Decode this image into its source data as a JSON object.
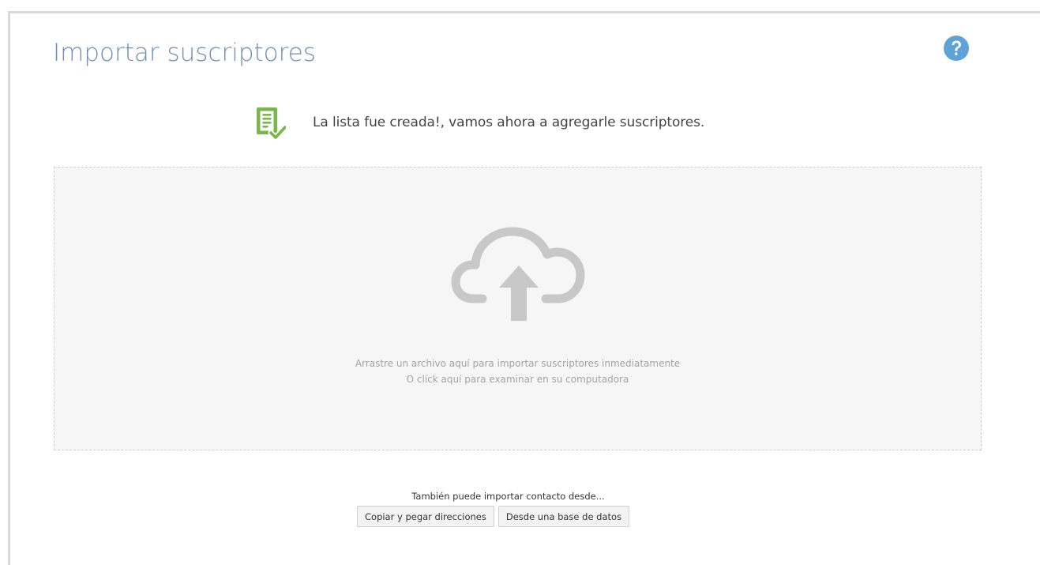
{
  "header": {
    "title": "Importar suscriptores",
    "help_icon": "question-circle-icon"
  },
  "notice": {
    "icon": "list-check-icon",
    "icon_color": "#7ab648",
    "text": "La lista fue creada!, vamos ahora a agregarle suscriptores."
  },
  "dropzone": {
    "icon": "cloud-upload-icon",
    "line1": "Arrastre un archivo aquí para importar suscriptores inmediatamente",
    "line2": "O click aquí para examinar en su computadora"
  },
  "alternatives": {
    "label": "También puede importar contacto desde...",
    "buttons": [
      {
        "label": "Copiar y pegar direcciones"
      },
      {
        "label": "Desde una base de datos"
      }
    ]
  },
  "colors": {
    "title": "#6f8fb6",
    "help": "#5ea2d8",
    "notice_icon": "#7ab648",
    "dropzone_bg": "#f6f6f6",
    "cloud": "#c8c8c8"
  }
}
